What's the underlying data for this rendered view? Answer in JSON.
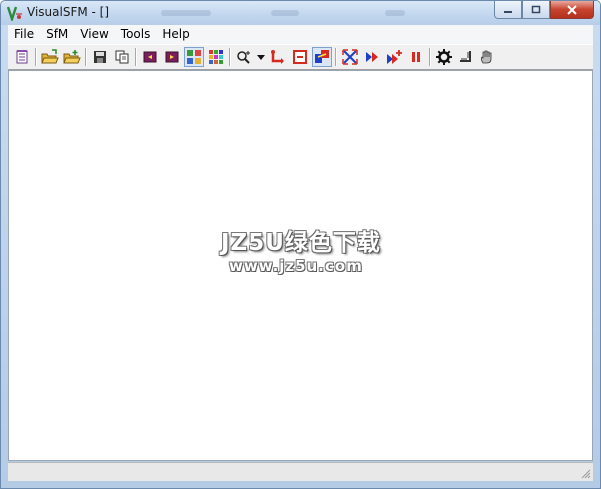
{
  "window": {
    "title": "VisualSFM - []"
  },
  "menu": {
    "items": [
      "File",
      "SfM",
      "View",
      "Tools",
      "Help"
    ]
  },
  "toolbar": {
    "buttons": [
      "notepad-icon",
      "open-folder-icon",
      "open-multiple-icon",
      "save-icon",
      "copy-icon",
      "prev-image-icon",
      "next-image-icon",
      "thumbnails-icon",
      "color-grid-icon",
      "zoom-icon",
      "dropdown-arrow-icon",
      "compute-match-icon",
      "remove-icon",
      "pair-view-icon",
      "fullscreen-icon",
      "run-sfm-icon",
      "run-step-icon",
      "pause-icon",
      "settings-gear-icon",
      "ruler-icon",
      "hand-pan-icon"
    ]
  },
  "canvas": {
    "watermark_line1": "JZ5U绿色下载",
    "watermark_line2": "www.jz5u.com"
  },
  "status": {
    "text": ""
  },
  "colors": {
    "titlebar": "#c3d7ef",
    "close_button": "#c7442f",
    "accent_red": "#d42a1f",
    "accent_blue": "#1f3fc4"
  }
}
